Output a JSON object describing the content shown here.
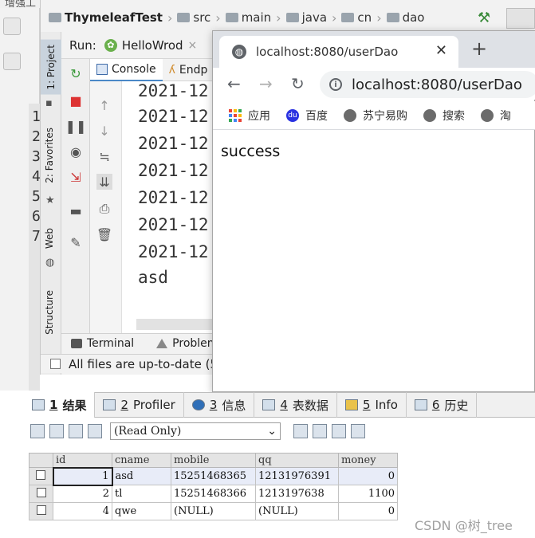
{
  "background_app": {
    "top_text": "增强工",
    "line_numbers": [
      "1",
      "2",
      "3",
      "4",
      "5",
      "6",
      "7"
    ]
  },
  "ide": {
    "breadcrumb": [
      "ThymeleafTest",
      "src",
      "main",
      "java",
      "cn",
      "dao"
    ],
    "side_tabs": [
      "1: Project",
      "2: Favorites",
      "Web",
      "Structure"
    ],
    "run_label": "Run:",
    "run_config": "HelloWrod",
    "console_tabs": [
      "Console",
      "Endp"
    ],
    "console_lines": [
      "2021-12",
      "2021-12",
      "2021-12",
      "2021-12",
      "2021-12",
      "2021-12",
      "2021-12",
      "asd"
    ],
    "bottom_tabs": [
      "Terminal",
      "Problem"
    ],
    "status_text": "All files are up-to-date (5"
  },
  "browser": {
    "tab_title": "localhost:8080/userDao",
    "url": "localhost:8080/userDao",
    "bookmarks": [
      "应用",
      "百度",
      "苏宁易购",
      "搜索",
      "淘"
    ],
    "body_text": "success"
  },
  "db_pane": {
    "tabs": [
      {
        "num": "1",
        "label": "结果"
      },
      {
        "num": "2",
        "label": "Profiler"
      },
      {
        "num": "3",
        "label": "信息"
      },
      {
        "num": "4",
        "label": "表数据"
      },
      {
        "num": "5",
        "label": "Info"
      },
      {
        "num": "6",
        "label": "历史"
      }
    ],
    "mode_select": "(Read Only)",
    "columns": [
      "id",
      "cname",
      "mobile",
      "qq",
      "money"
    ],
    "rows": [
      [
        "1",
        "asd",
        "15251468365",
        "12131976391",
        "0"
      ],
      [
        "2",
        "tl",
        "15251468366",
        "1213197638",
        "1100"
      ],
      [
        "4",
        "qwe",
        "(NULL)",
        "(NULL)",
        "0"
      ]
    ]
  },
  "watermark": "CSDN @树_tree",
  "colors": {
    "accent": "#4a88c7",
    "row_highlight": "#e8ecf8"
  }
}
